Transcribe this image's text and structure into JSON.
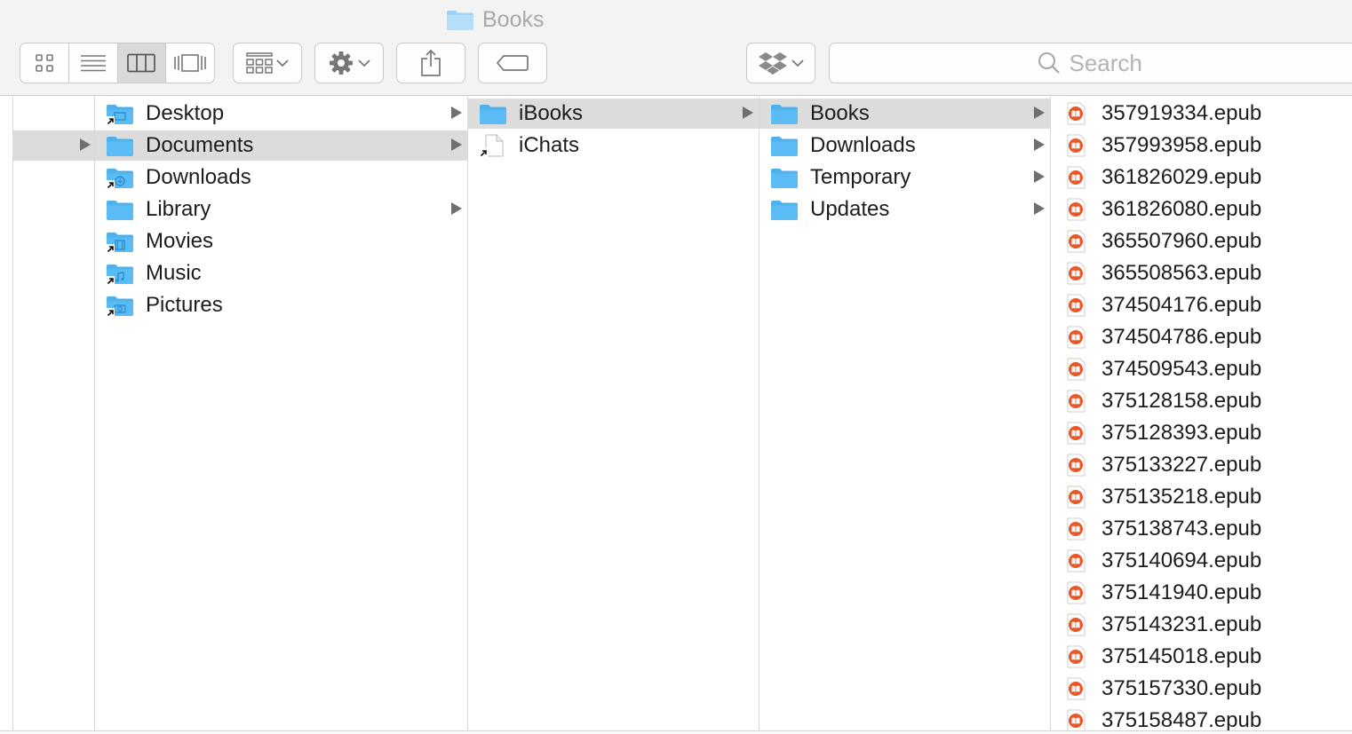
{
  "window": {
    "title": "Books",
    "title_icon": "folder-icon"
  },
  "toolbar": {
    "view_modes": [
      {
        "name": "icon-view",
        "icon": "grid-icon",
        "active": false
      },
      {
        "name": "list-view",
        "icon": "list-icon",
        "active": false
      },
      {
        "name": "column-view",
        "icon": "columns-icon",
        "active": true
      },
      {
        "name": "cover-flow-view",
        "icon": "coverflow-icon",
        "active": false
      }
    ],
    "arrange_icon": "arrange-grid-icon",
    "action_icon": "gear-icon",
    "share_icon": "share-icon",
    "tags_icon": "tag-icon",
    "dropbox_icon": "dropbox-icon",
    "search": {
      "placeholder": "Search",
      "value": ""
    }
  },
  "colors": {
    "folder": "#5bbcf5",
    "selection": "#dcdcdc",
    "epub": "#e8572a"
  },
  "columns": [
    {
      "name": "home",
      "items": [
        {
          "label": "Desktop",
          "icon": "desktop-folder-icon",
          "alias": true,
          "folder": true,
          "selected": false
        },
        {
          "label": "Documents",
          "icon": "folder-icon",
          "alias": false,
          "folder": true,
          "selected": true
        },
        {
          "label": "Downloads",
          "icon": "downloads-folder-icon",
          "alias": true,
          "folder": false,
          "selected": false
        },
        {
          "label": "Library",
          "icon": "folder-icon",
          "alias": false,
          "folder": true,
          "selected": false
        },
        {
          "label": "Movies",
          "icon": "movies-folder-icon",
          "alias": true,
          "folder": false,
          "selected": false
        },
        {
          "label": "Music",
          "icon": "music-folder-icon",
          "alias": true,
          "folder": false,
          "selected": false
        },
        {
          "label": "Pictures",
          "icon": "pictures-folder-icon",
          "alias": true,
          "folder": false,
          "selected": false
        }
      ]
    },
    {
      "name": "documents",
      "items": [
        {
          "label": "iBooks",
          "icon": "folder-icon",
          "alias": false,
          "folder": true,
          "selected": true
        },
        {
          "label": "iChats",
          "icon": "document-icon",
          "alias": true,
          "folder": false,
          "selected": false
        }
      ]
    },
    {
      "name": "ibooks",
      "items": [
        {
          "label": "Books",
          "icon": "folder-icon",
          "alias": false,
          "folder": true,
          "selected": true
        },
        {
          "label": "Downloads",
          "icon": "folder-icon",
          "alias": false,
          "folder": true,
          "selected": false
        },
        {
          "label": "Temporary",
          "icon": "folder-icon",
          "alias": false,
          "folder": true,
          "selected": false
        },
        {
          "label": "Updates",
          "icon": "folder-icon",
          "alias": false,
          "folder": true,
          "selected": false
        }
      ]
    },
    {
      "name": "books",
      "items": [
        {
          "label": "357919334.epub",
          "icon": "epub-icon"
        },
        {
          "label": "357993958.epub",
          "icon": "epub-icon"
        },
        {
          "label": "361826029.epub",
          "icon": "epub-icon"
        },
        {
          "label": "361826080.epub",
          "icon": "epub-icon"
        },
        {
          "label": "365507960.epub",
          "icon": "epub-icon"
        },
        {
          "label": "365508563.epub",
          "icon": "epub-icon"
        },
        {
          "label": "374504176.epub",
          "icon": "epub-icon"
        },
        {
          "label": "374504786.epub",
          "icon": "epub-icon"
        },
        {
          "label": "374509543.epub",
          "icon": "epub-icon"
        },
        {
          "label": "375128158.epub",
          "icon": "epub-icon"
        },
        {
          "label": "375128393.epub",
          "icon": "epub-icon"
        },
        {
          "label": "375133227.epub",
          "icon": "epub-icon"
        },
        {
          "label": "375135218.epub",
          "icon": "epub-icon"
        },
        {
          "label": "375138743.epub",
          "icon": "epub-icon"
        },
        {
          "label": "375140694.epub",
          "icon": "epub-icon"
        },
        {
          "label": "375141940.epub",
          "icon": "epub-icon"
        },
        {
          "label": "375143231.epub",
          "icon": "epub-icon"
        },
        {
          "label": "375145018.epub",
          "icon": "epub-icon"
        },
        {
          "label": "375157330.epub",
          "icon": "epub-icon"
        },
        {
          "label": "375158487.epub",
          "icon": "epub-icon"
        }
      ]
    }
  ],
  "parent_column": {
    "name": "parent",
    "selected_has_children": true
  }
}
